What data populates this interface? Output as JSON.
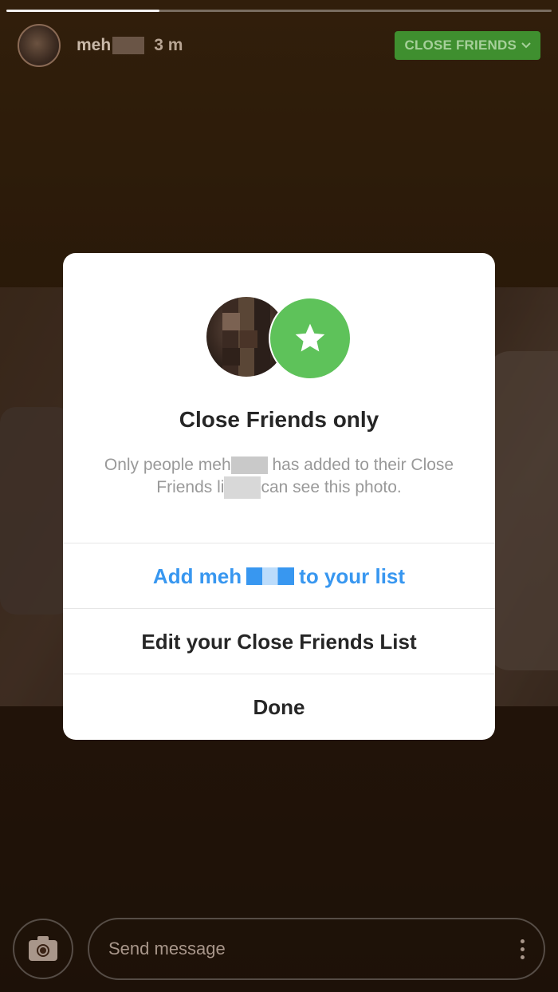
{
  "story": {
    "progress": 0.28,
    "username": "meh",
    "time": "3 m",
    "badge_label": "CLOSE FRIENDS"
  },
  "modal": {
    "title": "Close Friends only",
    "description_part1": "Only people meh",
    "description_part2": "has added to their Close",
    "description_part3": "Friends li",
    "description_part4": "can see this photo.",
    "add_part1": "Add meh",
    "add_part2": "to your list",
    "edit_label": "Edit your Close Friends List",
    "done_label": "Done"
  },
  "bottom": {
    "message_placeholder": "Send message"
  },
  "colors": {
    "accent_blue": "#3897f0",
    "close_friends_green": "#5ec25a",
    "badge_green": "#3f8f2f"
  }
}
